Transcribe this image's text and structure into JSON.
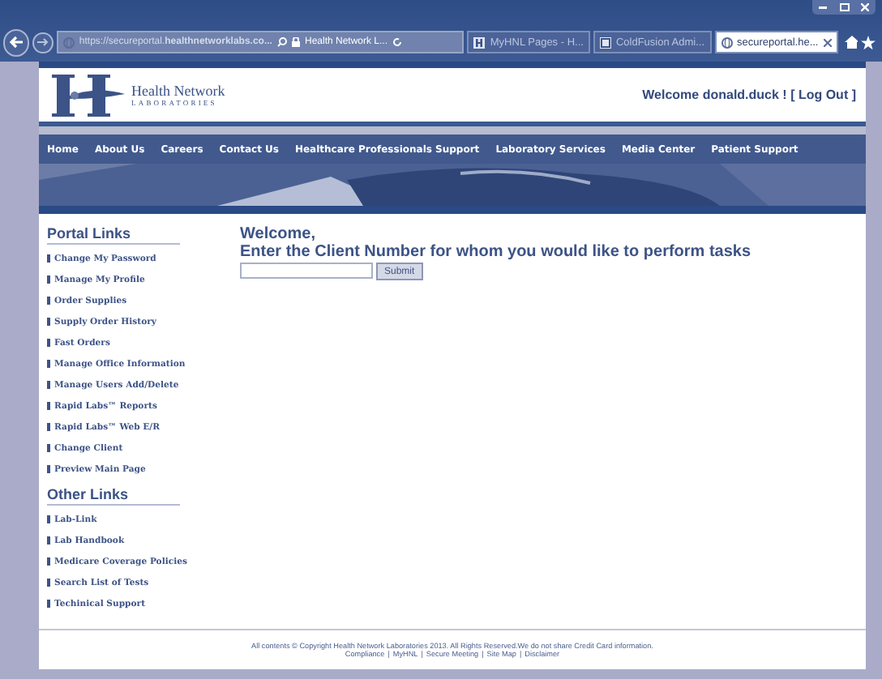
{
  "browser": {
    "address": "https://secureportal.**healthnetworklabs.co...**",
    "site_label": "Health Network L...",
    "tabs": [
      {
        "label": "MyHNL Pages - H...",
        "selected": false,
        "kind": "hnl"
      },
      {
        "label": "ColdFusion Admi...",
        "selected": false,
        "kind": "cf"
      },
      {
        "label": "secureportal.he...",
        "selected": true,
        "kind": "globe"
      }
    ]
  },
  "header": {
    "logo_name": "Health Network",
    "logo_sub": "LABORATORIES",
    "welcome": "Welcome donald.duck ! [ Log Out ]"
  },
  "nav": [
    "Home",
    "About Us",
    "Careers",
    "Contact Us",
    "Healthcare Professionals Support",
    "Laboratory Services",
    "Media Center",
    "Patient Support"
  ],
  "sidebar": [
    {
      "heading": "Portal Links",
      "links": [
        "Change My Password",
        "Manage My Profile",
        "Order Supplies",
        "Supply Order History",
        "Fast Orders",
        "Manage Office Information",
        "Manage Users Add/Delete",
        "Rapid Labs™ Reports",
        "Rapid Labs™ Web E/R",
        "Change Client",
        "Preview Main Page"
      ]
    },
    {
      "heading": "Other Links",
      "links": [
        "Lab-Link",
        "Lab Handbook",
        "Medicare Coverage Policies",
        "Search List of Tests",
        "Techinical Support"
      ]
    }
  ],
  "main": {
    "title": "Welcome,",
    "prompt": "Enter the Client Number for whom you would like to perform tasks",
    "submit": "Submit"
  },
  "footer": {
    "copyright": "All contents © Copyright Health Network Laboratories 2013. All Rights Reserved.We do not share Credit Card information.",
    "links": [
      "Compliance",
      "MyHNL",
      "Secure Meeting",
      "Site Map",
      "Disclaimer"
    ],
    "separator": "|"
  }
}
